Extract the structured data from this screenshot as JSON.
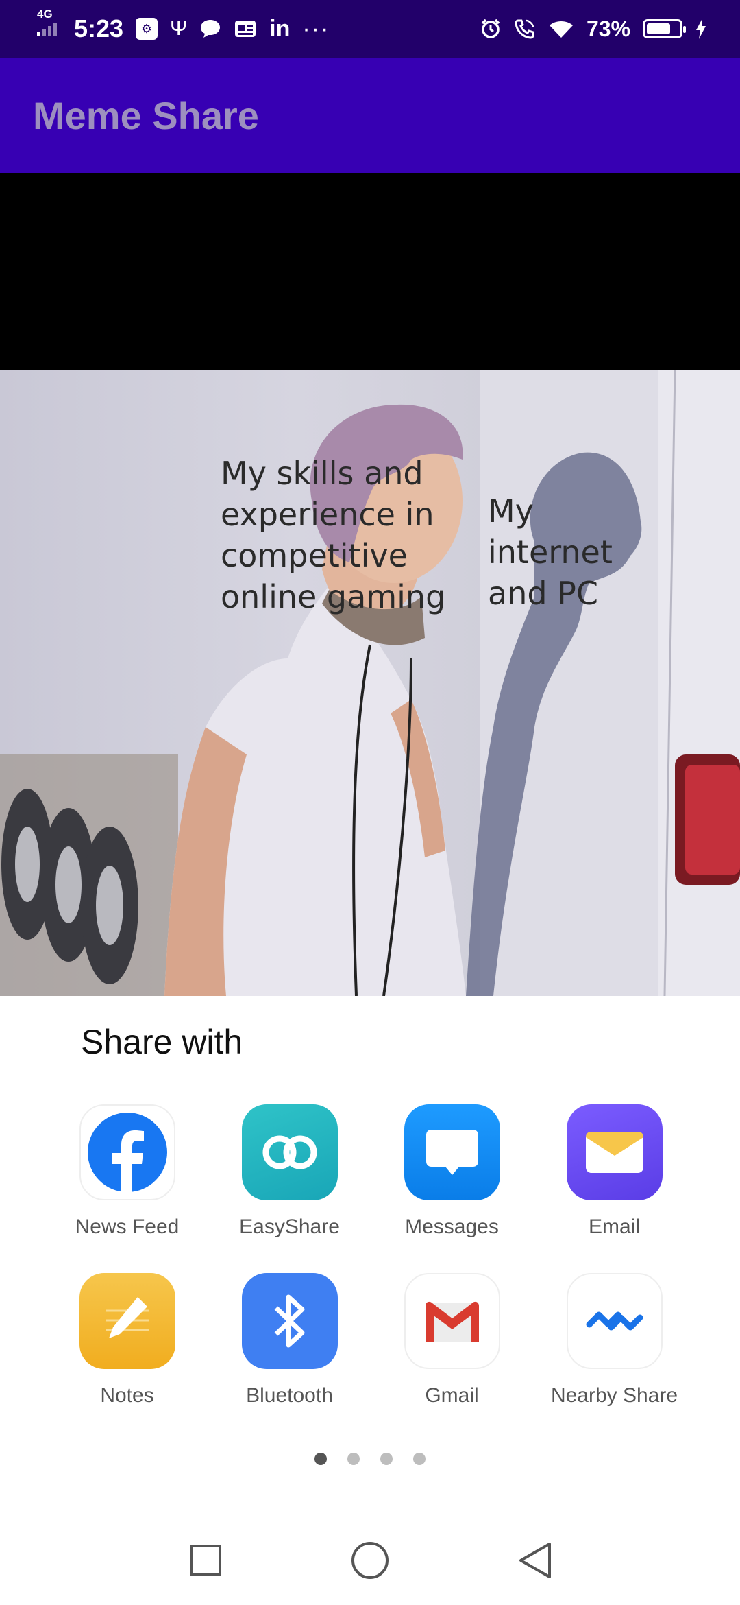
{
  "status_bar": {
    "network": "4G",
    "time": "5:23",
    "battery_percent": "73%",
    "battery_level": 0.73,
    "icons": [
      "signal-icon",
      "usb-debug-icon",
      "usb-icon",
      "chat-icon",
      "news-icon",
      "linkedin-icon",
      "more-icon",
      "alarm-icon",
      "wifi-call-icon",
      "wifi-icon",
      "battery-icon",
      "charging-icon"
    ],
    "linkedin_text": "in",
    "more_text": "···"
  },
  "app_bar": {
    "title": "Meme Share",
    "color": "#3700b3"
  },
  "meme": {
    "caption_left_lines": [
      "My skills and",
      "experience in",
      "competitive",
      "online gaming"
    ],
    "caption_right_lines": [
      "My",
      "internet",
      "and PC"
    ]
  },
  "share_sheet": {
    "title": "Share with",
    "apps": [
      {
        "label": "News Feed",
        "icon": "facebook-icon"
      },
      {
        "label": "EasyShare",
        "icon": "easyshare-icon"
      },
      {
        "label": "Messages",
        "icon": "messages-icon"
      },
      {
        "label": "Email",
        "icon": "email-icon"
      },
      {
        "label": "Notes",
        "icon": "notes-icon"
      },
      {
        "label": "Bluetooth",
        "icon": "bluetooth-icon"
      },
      {
        "label": "Gmail",
        "icon": "gmail-icon"
      },
      {
        "label": "Nearby Share",
        "icon": "nearby-share-icon"
      }
    ],
    "pages": 4,
    "active_page": 1
  },
  "nav_bar": {
    "buttons": [
      "recents-button",
      "home-button",
      "back-button"
    ]
  }
}
